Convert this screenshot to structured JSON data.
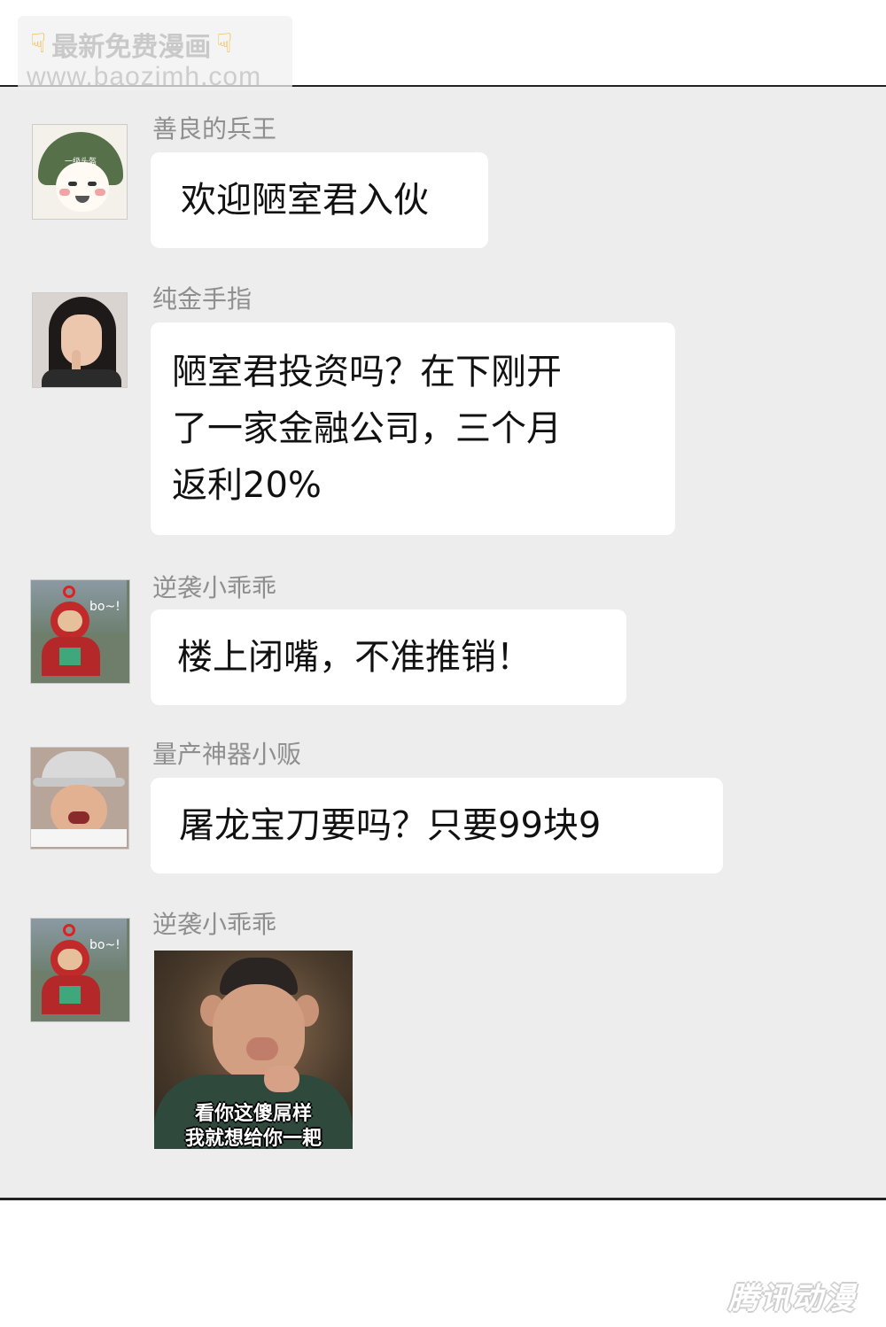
{
  "watermark": {
    "line1": "最新免费漫画",
    "line2": "www.baozimh.com",
    "icon": "pointing-down-hand-icon"
  },
  "messages": [
    {
      "sender": "善良的兵王",
      "avatar": "helmet-soldier-emoji-avatar",
      "avatar_text": "一级头盔",
      "lines": [
        "欢迎陋室君入伙"
      ]
    },
    {
      "sender": "纯金手指",
      "avatar": "girl-finger-photo-avatar",
      "lines": [
        "陋室君投资吗？在下刚开",
        "了一家金融公司，三个月",
        "返利20%"
      ]
    },
    {
      "sender": "逆袭小乖乖",
      "avatar": "teletubby-avatar",
      "avatar_text": "bo~!",
      "lines": [
        "楼上闭嘴，不准推销！"
      ]
    },
    {
      "sender": "量产神器小贩",
      "avatar": "crying-vendor-photo-avatar",
      "lines": [
        "屠龙宝刀要吗？只要99块9"
      ]
    },
    {
      "sender": "逆袭小乖乖",
      "avatar": "teletubby-avatar",
      "avatar_text": "bo~!",
      "sticker": {
        "subject": "pigsy-pointing-meme",
        "caption_line1": "看你这傻屌样",
        "caption_line2": "我就想给你一耙"
      }
    }
  ],
  "footer": {
    "watermark": "腾讯动漫"
  }
}
